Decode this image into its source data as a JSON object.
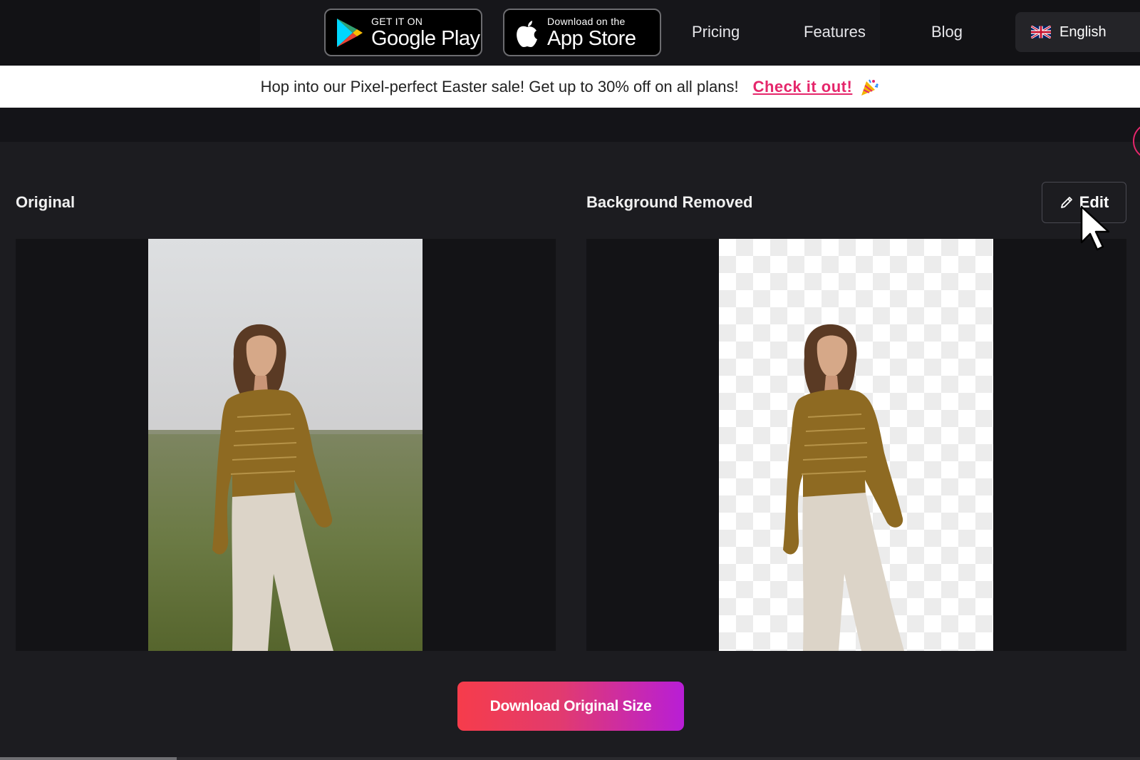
{
  "nav": {
    "google_play": {
      "small": "GET IT ON",
      "big": "Google Play"
    },
    "app_store": {
      "small": "Download on the",
      "big": "App Store"
    },
    "links": [
      "Pricing",
      "Features",
      "Blog"
    ],
    "language": "English"
  },
  "promo": {
    "text": "Hop into our Pixel-perfect Easter sale! Get up to 30% off on all plans!",
    "link": "Check it out!",
    "link_color": "#e5266b"
  },
  "panels": {
    "original_label": "Original",
    "removed_label": "Background Removed",
    "edit_label": "Edit"
  },
  "download_label": "Download Original Size",
  "colors": {
    "background": "#1c1c20",
    "accent_gradient_start": "#f63c4b",
    "accent_gradient_end": "#b81ed6"
  },
  "icons": [
    "google-play-icon",
    "apple-icon",
    "uk-flag-icon",
    "pencil-icon",
    "party-popper-icon",
    "mouse-cursor-icon"
  ]
}
